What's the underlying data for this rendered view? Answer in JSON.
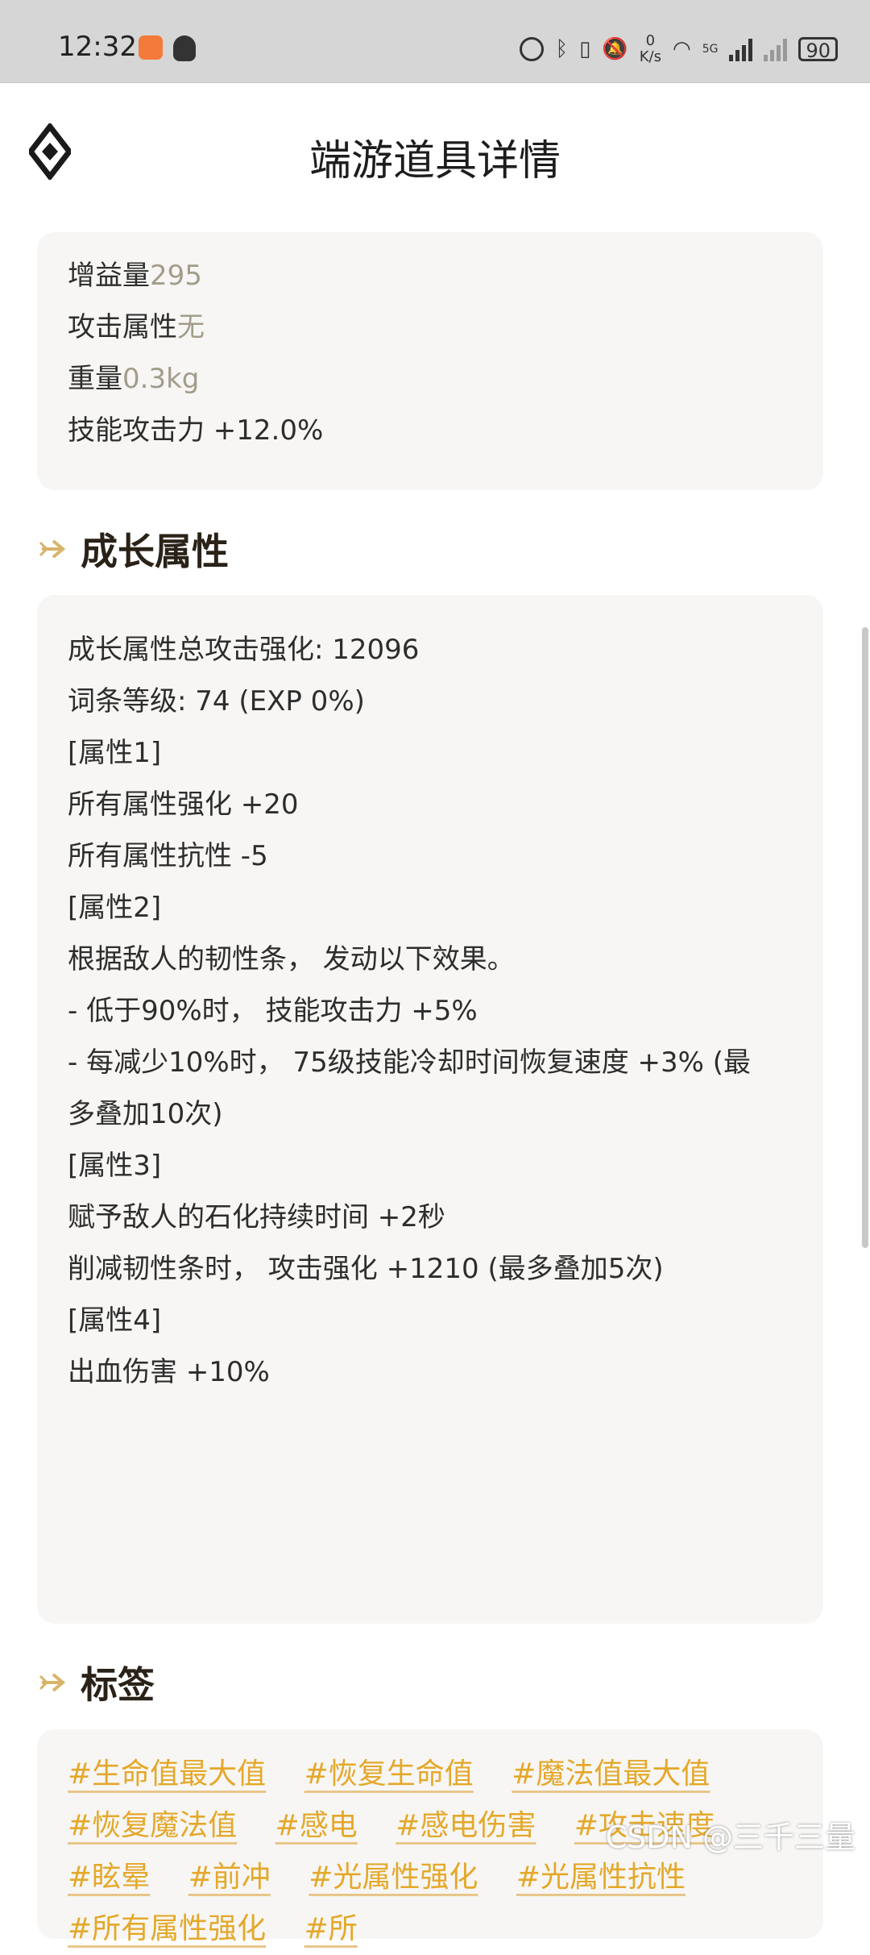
{
  "status_bar": {
    "time": "12:32",
    "net_speed_value": "0",
    "net_speed_unit": "K/s",
    "network_type": "5G",
    "battery": "90"
  },
  "header": {
    "title": "端游道具详情"
  },
  "basic_attributes": [
    {
      "label": "增益量",
      "value": "295"
    },
    {
      "label": "攻击属性",
      "value": "无"
    },
    {
      "label": "重量",
      "value": "0.3kg"
    },
    {
      "label": "技能攻击力 +12.0%",
      "value": ""
    }
  ],
  "growth_section": {
    "title": "成长属性",
    "lines": [
      "成长属性总攻击强化: 12096",
      "词条等级: 74 (EXP 0%)",
      "[属性1]",
      "所有属性强化 +20",
      "所有属性抗性 -5",
      "",
      "[属性2]",
      "根据敌人的韧性条， 发动以下效果。",
      "- 低于90%时， 技能攻击力 +5%",
      "- 每减少10%时， 75级技能冷却时间恢复速度 +3% (最",
      "多叠加10次)",
      "",
      "[属性3]",
      "赋予敌人的石化持续时间 +2秒",
      "削减韧性条时， 攻击强化 +1210 (最多叠加5次)",
      "",
      "[属性4]",
      "出血伤害 +10%"
    ]
  },
  "tags_section": {
    "title": "标签",
    "tags": [
      "#生命值最大值",
      "#恢复生命值",
      "#魔法值最大值",
      "#恢复魔法值",
      "#感电",
      "#感电伤害",
      "#攻击速度",
      "#眩晕",
      "#前冲",
      "#光属性强化",
      "#光属性抗性",
      "#所有属性强化",
      "#所"
    ]
  },
  "watermark": "CSDN @三千三量",
  "colors": {
    "accent": "#e4a82a",
    "value_text": "#a39c8a",
    "card_bg": "#f7f6f4"
  }
}
